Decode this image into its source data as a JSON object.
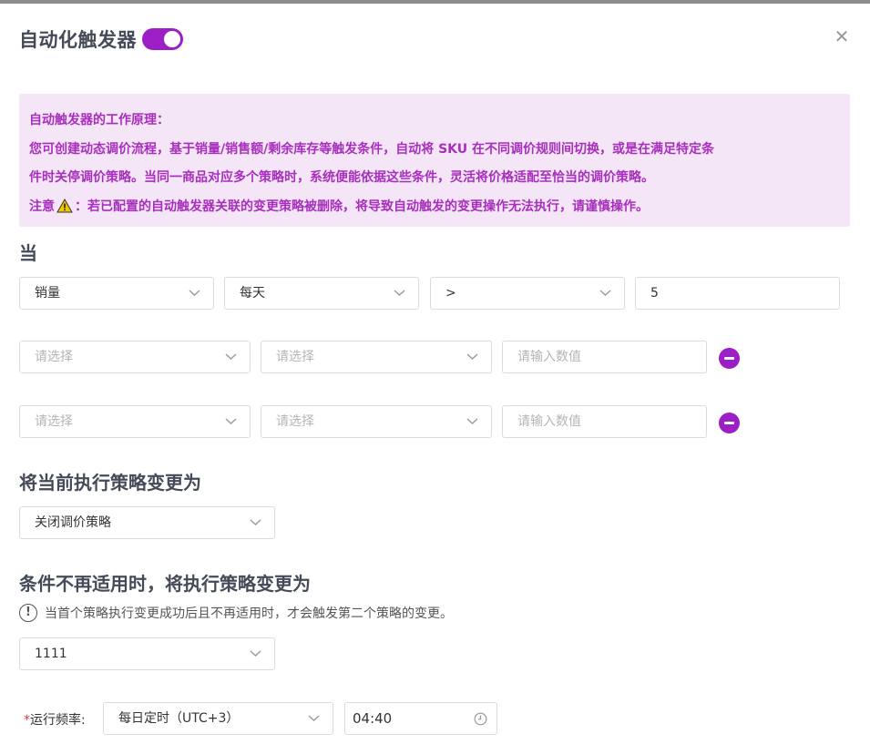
{
  "header": {
    "title": "自动化触发器",
    "toggle_on": true
  },
  "notice": {
    "line1": "自动触发器的工作原理：",
    "line2": "您可创建动态调价流程，基于销量/销售额/剩余库存等触发条件，自动将 SKU 在不同调价规则间切换，或是在满足特定条",
    "line3": "件时关停调价策略。当同一商品对应多个策略时，系统便能依据这些条件，灵活将价格适配至恰当的调价策略。",
    "line4_prefix": "注意",
    "line4_suffix": "：若已配置的自动触发器关联的变更策略被删除，将导致自动触发的变更操作无法执行，请谨慎操作。"
  },
  "when": {
    "heading": "当",
    "row1": {
      "metric": "销量",
      "period": "每天",
      "operator": ">",
      "value": "5"
    },
    "row2": {
      "select1_placeholder": "请选择",
      "select2_placeholder": "请选择",
      "input_placeholder": "请输入数值"
    },
    "row3": {
      "select1_placeholder": "请选择",
      "select2_placeholder": "请选择",
      "input_placeholder": "请输入数值"
    }
  },
  "change_to": {
    "heading": "将当前执行策略变更为",
    "value": "关闭调价策略"
  },
  "fallback": {
    "heading": "条件不再适用时，将执行策略变更为",
    "info": "当首个策略执行变更成功后且不再适用时，才会触发第二个策略的变更。",
    "value": "1111"
  },
  "frequency": {
    "required_mark": "*",
    "label": "运行频率:",
    "schedule": "每日定时（UTC+3）",
    "time": "04:40"
  },
  "colors": {
    "accent": "#9b1fc5",
    "notice_bg": "#f4e6f6",
    "notice_text": "#a82fbd"
  }
}
